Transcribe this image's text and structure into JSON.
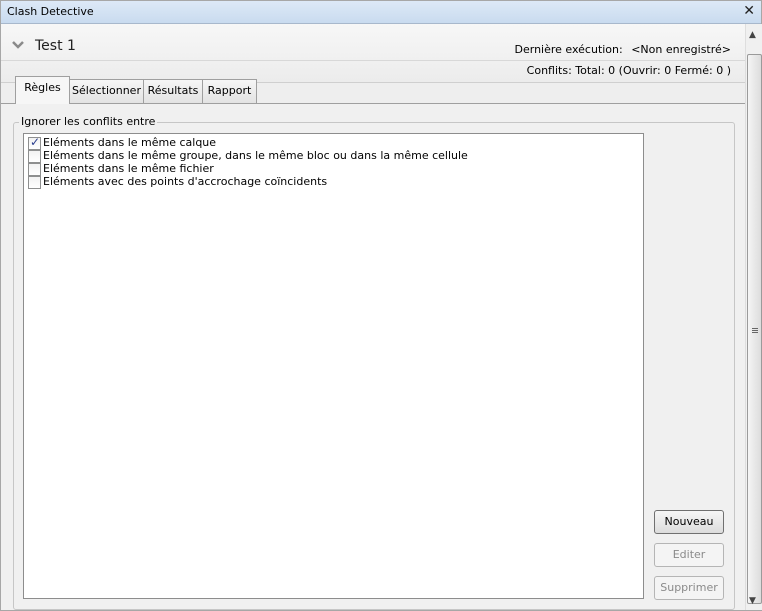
{
  "window": {
    "title": "Clash Detective",
    "close_glyph": "✕"
  },
  "header": {
    "test_name": "Test 1",
    "last_run_label": "Dernière exécution:",
    "last_run_value": "<Non enregistré>",
    "conflicts_text": "Conflits:  Total:  0  (Ouvrir:  0  Fermé:  0 )"
  },
  "tabs": [
    {
      "label": "Règles",
      "active": true
    },
    {
      "label": "Sélectionner",
      "active": false
    },
    {
      "label": "Résultats",
      "active": false
    },
    {
      "label": "Rapport",
      "active": false
    }
  ],
  "rules": {
    "group_label": "Ignorer les conflits entre",
    "items": [
      {
        "label": "Eléments dans le même calque",
        "checked": true
      },
      {
        "label": "Eléments dans le même groupe, dans le même bloc ou dans la même cellule",
        "checked": false
      },
      {
        "label": "Eléments dans le même fichier",
        "checked": false
      },
      {
        "label": "Eléments avec des points d'accrochage coïncidents",
        "checked": false
      }
    ]
  },
  "buttons": {
    "new_label": "Nouveau",
    "edit_label": "Editer",
    "delete_label": "Supprimer"
  }
}
